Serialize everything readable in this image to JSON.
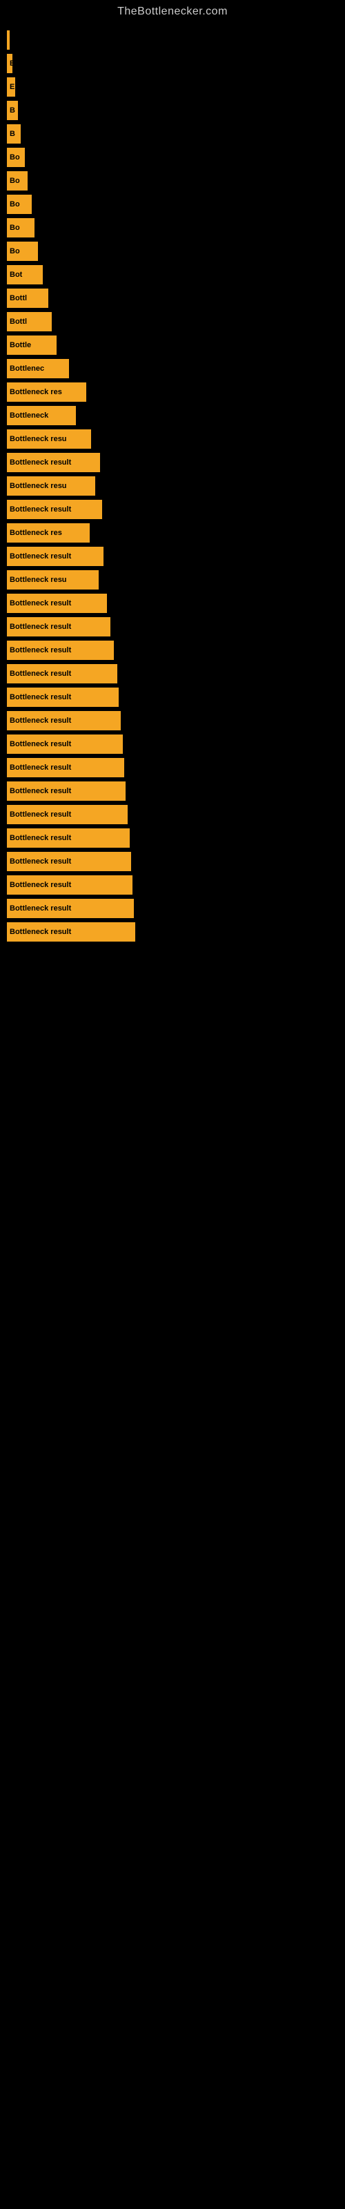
{
  "header": {
    "title": "TheBottlenecker.com"
  },
  "bars": [
    {
      "label": "",
      "width": 4
    },
    {
      "label": "E",
      "width": 8
    },
    {
      "label": "E",
      "width": 12
    },
    {
      "label": "B",
      "width": 16
    },
    {
      "label": "B",
      "width": 20
    },
    {
      "label": "Bo",
      "width": 26
    },
    {
      "label": "Bo",
      "width": 30
    },
    {
      "label": "Bo",
      "width": 36
    },
    {
      "label": "Bo",
      "width": 40
    },
    {
      "label": "Bo",
      "width": 45
    },
    {
      "label": "Bot",
      "width": 52
    },
    {
      "label": "Bottl",
      "width": 60
    },
    {
      "label": "Bottl",
      "width": 65
    },
    {
      "label": "Bottle",
      "width": 72
    },
    {
      "label": "Bottlenec",
      "width": 90
    },
    {
      "label": "Bottleneck res",
      "width": 115
    },
    {
      "label": "Bottleneck",
      "width": 100
    },
    {
      "label": "Bottleneck resu",
      "width": 122
    },
    {
      "label": "Bottleneck result",
      "width": 135
    },
    {
      "label": "Bottleneck resu",
      "width": 128
    },
    {
      "label": "Bottleneck result",
      "width": 138
    },
    {
      "label": "Bottleneck res",
      "width": 120
    },
    {
      "label": "Bottleneck result",
      "width": 140
    },
    {
      "label": "Bottleneck resu",
      "width": 133
    },
    {
      "label": "Bottleneck result",
      "width": 145
    },
    {
      "label": "Bottleneck result",
      "width": 150
    },
    {
      "label": "Bottleneck result",
      "width": 155
    },
    {
      "label": "Bottleneck result",
      "width": 160
    },
    {
      "label": "Bottleneck result",
      "width": 162
    },
    {
      "label": "Bottleneck result",
      "width": 165
    },
    {
      "label": "Bottleneck result",
      "width": 168
    },
    {
      "label": "Bottleneck result",
      "width": 170
    },
    {
      "label": "Bottleneck result",
      "width": 172
    },
    {
      "label": "Bottleneck result",
      "width": 175
    },
    {
      "label": "Bottleneck result",
      "width": 178
    },
    {
      "label": "Bottleneck result",
      "width": 180
    },
    {
      "label": "Bottleneck result",
      "width": 182
    },
    {
      "label": "Bottleneck result",
      "width": 184
    },
    {
      "label": "Bottleneck result",
      "width": 186
    }
  ]
}
